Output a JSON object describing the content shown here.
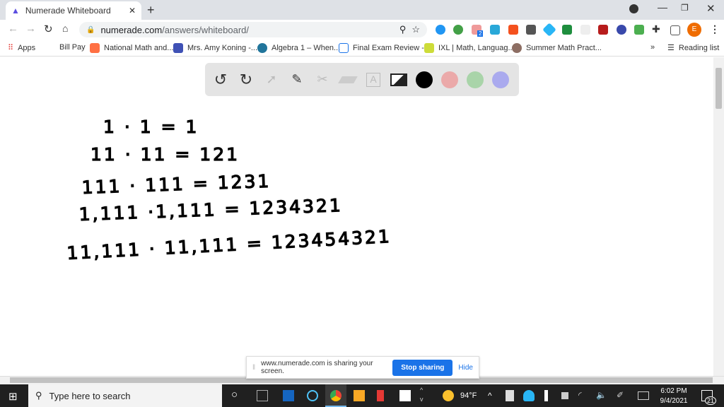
{
  "browser": {
    "tab_title": "Numerade Whiteboard",
    "url_domain": "numerade.com",
    "url_path": "/answers/whiteboard/",
    "profile_initial": "E",
    "extension_badge": "2",
    "bookmarks": [
      "Apps",
      "Bill Pay",
      "National Math and...",
      "Mrs. Amy Koning -...",
      "Algebra 1 – When...",
      "Final Exam Review -...",
      "IXL | Math, Languag...",
      "Summer Math Pract..."
    ],
    "more": "»",
    "reading_list": "Reading list"
  },
  "whiteboard": {
    "tools": [
      "undo",
      "redo",
      "select",
      "pen",
      "tools",
      "eraser",
      "text",
      "image"
    ],
    "colors": [
      "#000000",
      "#eba9a9",
      "#a9d4a9",
      "#aaaaee"
    ],
    "lines": [
      "1 · 1  =  1",
      "11 · 11  =  121",
      "111 · 111 = 1231",
      "1,111 ·1,111 = 1234321",
      "11,111 · 11,111 = 123454321"
    ]
  },
  "share_bar": {
    "message": "www.numerade.com is sharing your screen.",
    "stop": "Stop sharing",
    "hide": "Hide"
  },
  "taskbar": {
    "search_placeholder": "Type here to search",
    "weather": "94°F",
    "time": "6:02 PM",
    "date": "9/4/2021",
    "notifications": "21"
  }
}
